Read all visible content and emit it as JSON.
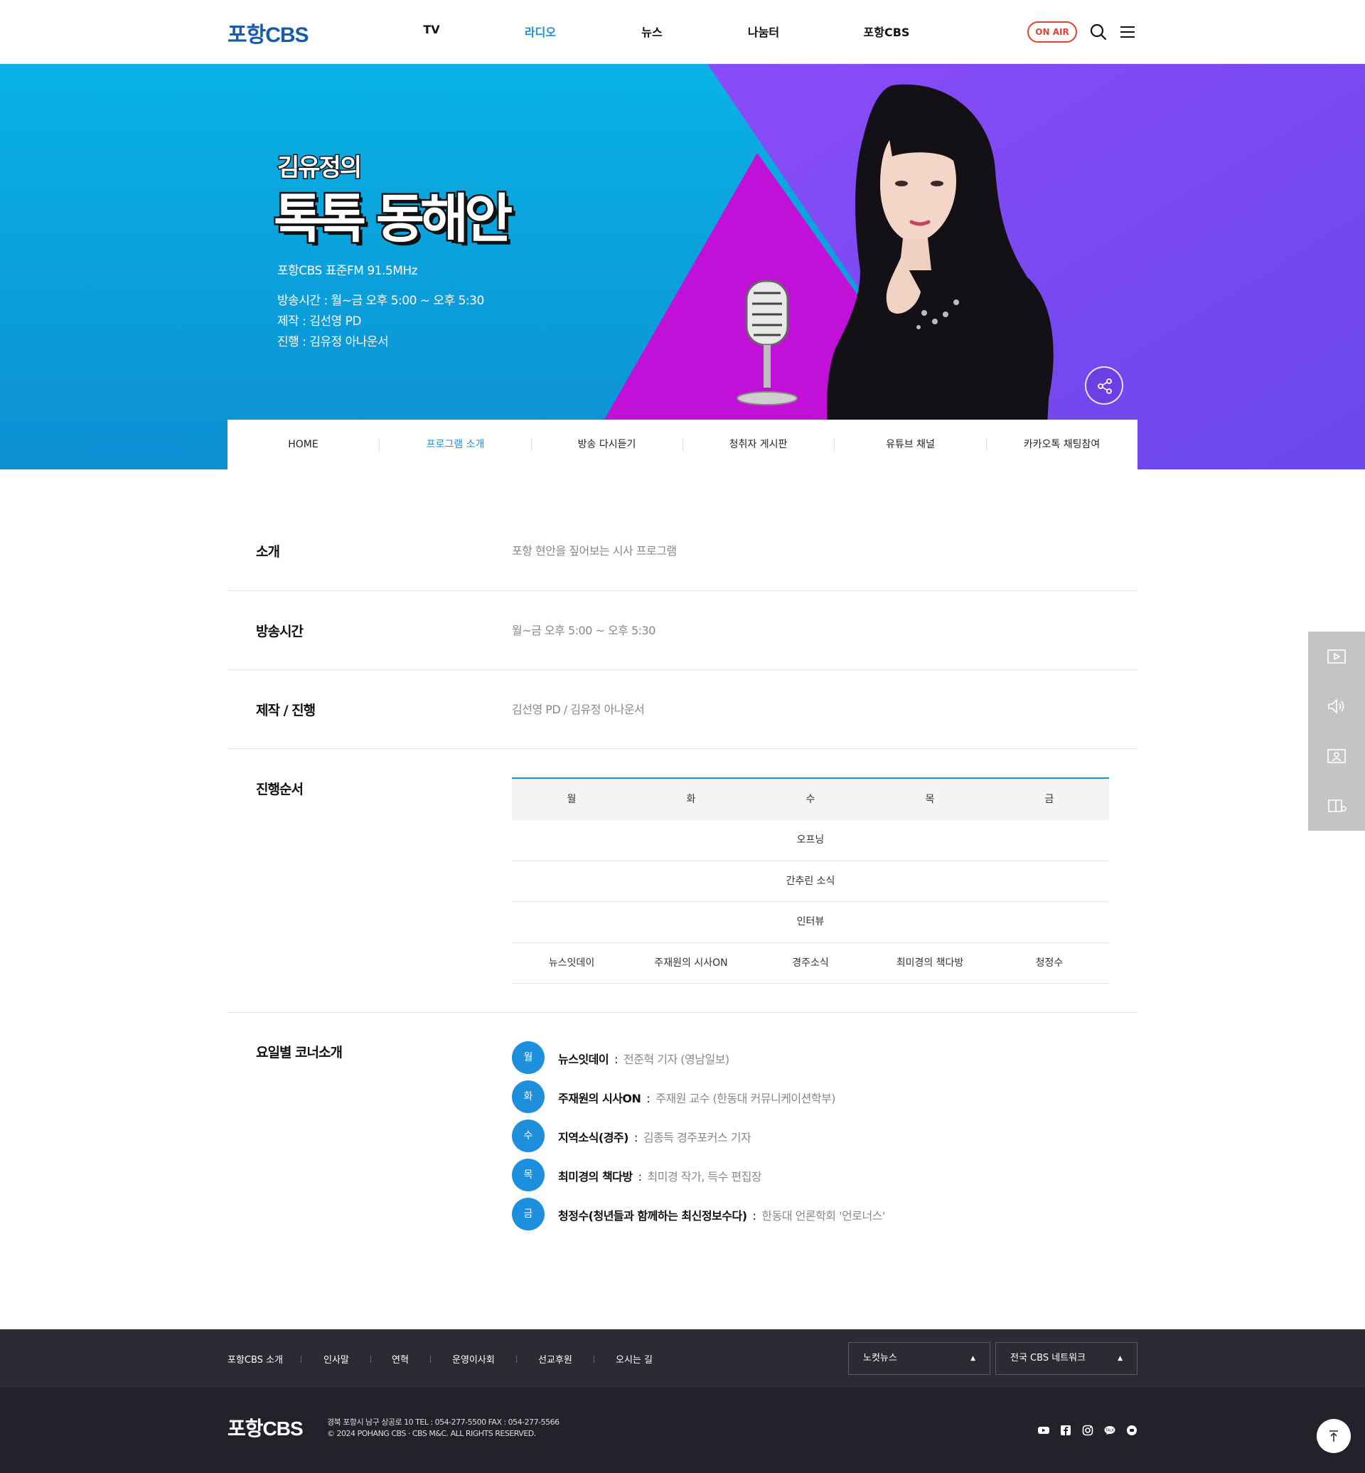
{
  "header": {
    "logo": "포항CBS",
    "nav": [
      "TV",
      "라디오",
      "뉴스",
      "나눔터",
      "포항CBS"
    ],
    "nav_active_index": 1,
    "onair_label": "ON AIR"
  },
  "hero": {
    "title_small": "김유정의",
    "title_big": "톡톡 동해안",
    "frequency": "포항CBS 표준FM 91.5MHz",
    "airtime": "방송시간 : 월~금 오후 5:00 ~ 오후 5:30",
    "producer": "제작 : 김선영 PD",
    "host": "진행 : 김유정 아나운서",
    "colors": {
      "left": "#12a9e0",
      "right": "#7a4cf0",
      "triangle": "#c010d8"
    }
  },
  "subnav": {
    "items": [
      "HOME",
      "프로그램 소개",
      "방송 다시듣기",
      "청취자 게시판",
      "유튜브 채널",
      "카카오톡 채팅참여"
    ],
    "active_index": 1
  },
  "info": {
    "intro_label": "소개",
    "intro_value": "포항 현안을 짚어보는 시사 프로그램",
    "time_label": "방송시간",
    "time_value": "월~금 오후 5:00 ~ 오후 5:30",
    "staff_label": "제작 / 진행",
    "staff_value": "김선영 PD / 김유정 아나운서",
    "order_label": "진행순서",
    "corner_label": "요일별 코너소개"
  },
  "schedule": {
    "days": [
      "월",
      "화",
      "수",
      "목",
      "금"
    ],
    "common_rows": [
      "오프닝",
      "간추린 소식",
      "인터뷰"
    ],
    "daily_row": [
      "뉴스잇데이",
      "주재원의 시사ON",
      "경주소식",
      "최미경의 책다방",
      "청정수"
    ]
  },
  "corners": [
    {
      "day": "월",
      "name": "뉴스잇데이",
      "desc": "전준혁 기자 (영남일보)"
    },
    {
      "day": "화",
      "name": "주재원의 시사ON",
      "desc": "주재원 교수 (한동대 커뮤니케이션학부)"
    },
    {
      "day": "수",
      "name": "지역소식(경주)",
      "desc": "김종득 경주포커스 기자"
    },
    {
      "day": "목",
      "name": "최미경의 책다방",
      "desc": "최미경 작가, 득수 편집장"
    },
    {
      "day": "금",
      "name": "청정수(청년들과 함께하는 최신정보수다)",
      "desc": "한동대 언론학회 '언로너스'"
    }
  ],
  "corner_colon": ":",
  "quick_menu": [
    "play-icon",
    "speaker-icon",
    "gallery-icon",
    "book-icon"
  ],
  "footer": {
    "links": [
      "포항CBS 소개",
      "인사말",
      "연혁",
      "운영이사회",
      "선교후원",
      "오시는 길"
    ],
    "select1": "노컷뉴스",
    "select2": "전국 CBS 네트워크",
    "caret": "▲",
    "logo": "포항CBS",
    "address": "경북 포항시 남구 상공로 10     TEL : 054-277-5500     FAX : 054-277-5566",
    "copyright": "© 2024 POHANG CBS · CBS M&C. ALL RIGHTS RESERVED.",
    "sns": [
      "youtube-icon",
      "facebook-icon",
      "instagram-icon",
      "kakaotalk-icon",
      "kakaostory-icon"
    ]
  }
}
